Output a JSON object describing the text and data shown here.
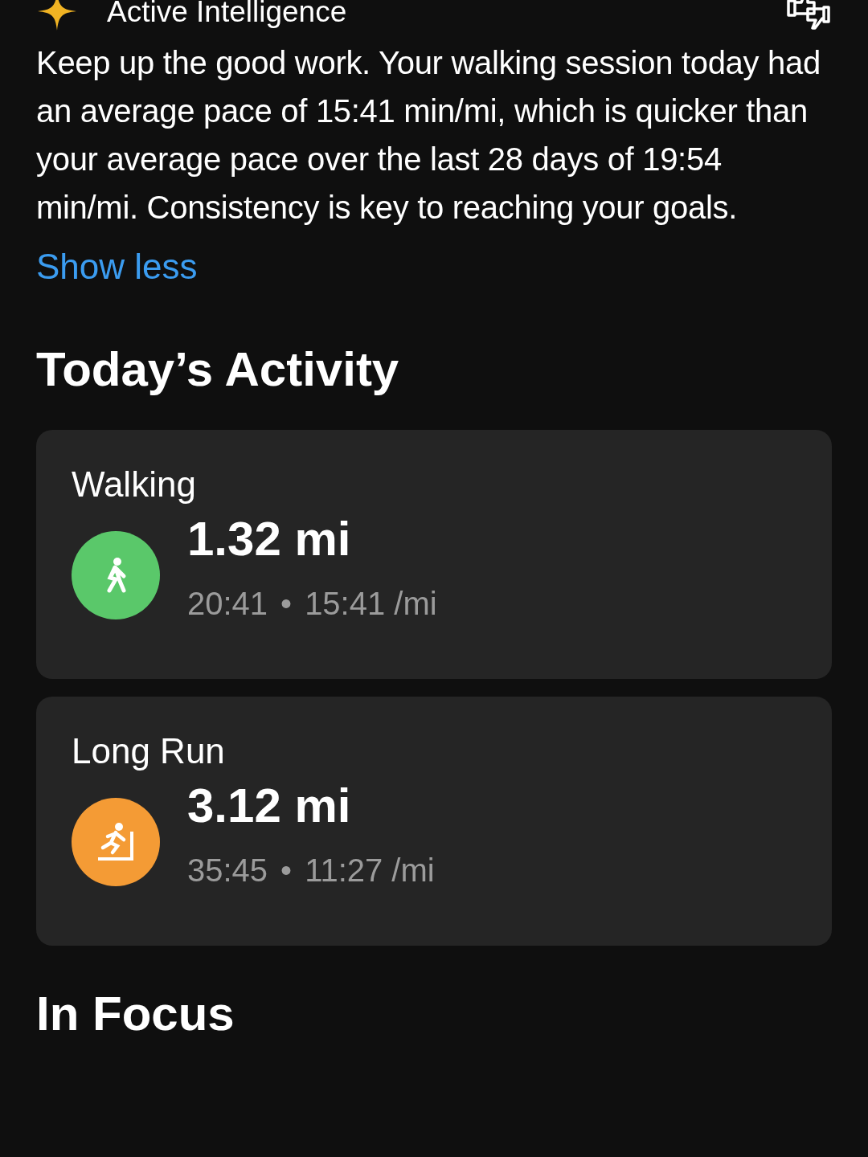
{
  "insight": {
    "title": "Active Intelligence",
    "text": "Keep up the good work. Your walking session today had an average pace of 15:41 min/mi, which is quicker than your average pace over the last 28 days of 19:54 min/mi. Consistency is key to reaching your goals.",
    "toggle": "Show less"
  },
  "section_title": "Today’s Activity",
  "activities": [
    {
      "name": "Walking",
      "kind": "walk",
      "color": "#5ac86a",
      "distance": "1.32 mi",
      "duration": "20:41",
      "separator": "•",
      "pace": "15:41 /mi"
    },
    {
      "name": "Long Run",
      "kind": "treadmill",
      "color": "#f49b35",
      "distance": "3.12 mi",
      "duration": "35:45",
      "separator": "•",
      "pace": "11:27 /mi"
    }
  ],
  "next_section_title": "In Focus"
}
